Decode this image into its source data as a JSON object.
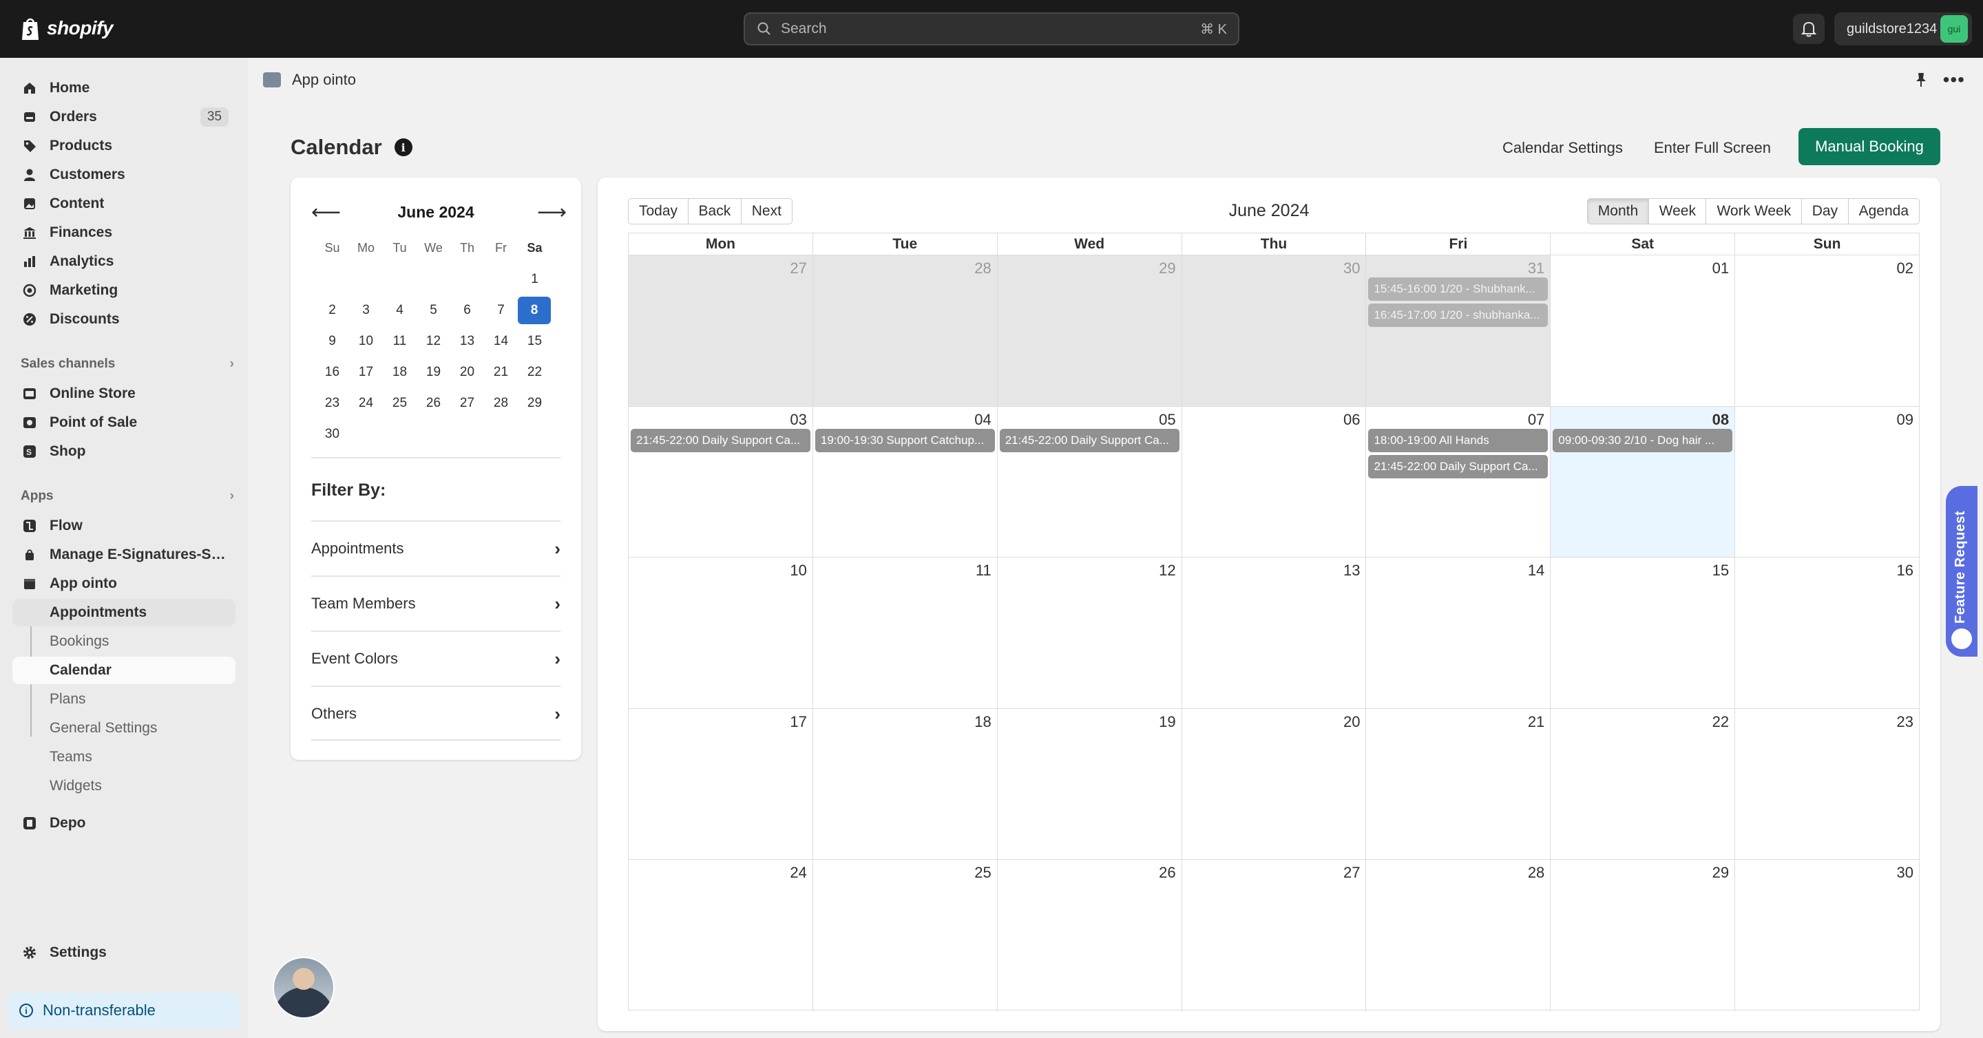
{
  "topbar": {
    "logo_text": "shopify",
    "search_placeholder": "Search",
    "search_shortcut": "⌘ K",
    "account_name": "guildstore1234",
    "account_avatar": "gui"
  },
  "sidebar": {
    "main": [
      {
        "label": "Home",
        "icon": "home-icon"
      },
      {
        "label": "Orders",
        "icon": "orders-icon",
        "badge": "35"
      },
      {
        "label": "Products",
        "icon": "tag-icon"
      },
      {
        "label": "Customers",
        "icon": "person-icon"
      },
      {
        "label": "Content",
        "icon": "content-icon"
      },
      {
        "label": "Finances",
        "icon": "bank-icon"
      },
      {
        "label": "Analytics",
        "icon": "chart-icon"
      },
      {
        "label": "Marketing",
        "icon": "target-icon"
      },
      {
        "label": "Discounts",
        "icon": "discount-icon"
      }
    ],
    "sales_channels_header": "Sales channels",
    "sales_channels": [
      {
        "label": "Online Store",
        "icon": "store-icon"
      },
      {
        "label": "Point of Sale",
        "icon": "pos-icon"
      },
      {
        "label": "Shop",
        "icon": "shop-icon"
      }
    ],
    "apps_header": "Apps",
    "apps": [
      {
        "label": "Flow",
        "icon": "flow-icon"
      },
      {
        "label": "Manage E-Signatures-Sig...",
        "icon": "signature-icon"
      },
      {
        "label": "App ointo",
        "icon": "calendar-app-icon"
      }
    ],
    "app_sub": [
      "Appointments",
      "Bookings",
      "Calendar",
      "Plans",
      "General Settings",
      "Teams",
      "Widgets"
    ],
    "depo": "Depo",
    "settings": "Settings",
    "non_transferable": "Non-transferable"
  },
  "app_header": {
    "title": "App ointo"
  },
  "page": {
    "title": "Calendar",
    "calendar_settings": "Calendar Settings",
    "full_screen": "Enter Full Screen",
    "manual_booking": "Manual Booking"
  },
  "mini_calendar": {
    "title": "June 2024",
    "dow": [
      "Su",
      "Mo",
      "Tu",
      "We",
      "Th",
      "Fr",
      "Sa"
    ],
    "weeks": [
      [
        "",
        "",
        "",
        "",
        "",
        "",
        "1"
      ],
      [
        "2",
        "3",
        "4",
        "5",
        "6",
        "7",
        "8"
      ],
      [
        "9",
        "10",
        "11",
        "12",
        "13",
        "14",
        "15"
      ],
      [
        "16",
        "17",
        "18",
        "19",
        "20",
        "21",
        "22"
      ],
      [
        "23",
        "24",
        "25",
        "26",
        "27",
        "28",
        "29"
      ],
      [
        "30",
        "",
        "",
        "",
        "",
        "",
        ""
      ]
    ],
    "selected": "8"
  },
  "filters": {
    "title": "Filter By:",
    "items": [
      "Appointments",
      "Team Members",
      "Event Colors",
      "Others"
    ]
  },
  "calendar": {
    "nav_buttons": [
      "Today",
      "Back",
      "Next"
    ],
    "title": "June 2024",
    "views": [
      "Month",
      "Week",
      "Work Week",
      "Day",
      "Agenda"
    ],
    "active_view": "Month",
    "dow": [
      "Mon",
      "Tue",
      "Wed",
      "Thu",
      "Fri",
      "Sat",
      "Sun"
    ],
    "weeks": [
      [
        {
          "num": "27",
          "off": true,
          "events": []
        },
        {
          "num": "28",
          "off": true,
          "events": []
        },
        {
          "num": "29",
          "off": true,
          "events": []
        },
        {
          "num": "30",
          "off": true,
          "events": []
        },
        {
          "num": "31",
          "off": true,
          "events": [
            "15:45-16:00 1/20 - Shubhank...",
            "16:45-17:00 1/20 - shubhanka..."
          ]
        },
        {
          "num": "01",
          "off": false,
          "events": []
        },
        {
          "num": "02",
          "off": false,
          "events": []
        }
      ],
      [
        {
          "num": "03",
          "off": false,
          "events": [
            "21:45-22:00 Daily Support Ca..."
          ]
        },
        {
          "num": "04",
          "off": false,
          "events": [
            "19:00-19:30 Support Catchup..."
          ]
        },
        {
          "num": "05",
          "off": false,
          "events": [
            "21:45-22:00 Daily Support Ca..."
          ]
        },
        {
          "num": "06",
          "off": false,
          "events": []
        },
        {
          "num": "07",
          "off": false,
          "events": [
            "18:00-19:00 All Hands",
            "21:45-22:00 Daily Support Ca..."
          ]
        },
        {
          "num": "08",
          "off": false,
          "today": true,
          "events": [
            "09:00-09:30 2/10 - Dog hair ..."
          ]
        },
        {
          "num": "09",
          "off": false,
          "events": []
        }
      ],
      [
        {
          "num": "10",
          "events": []
        },
        {
          "num": "11",
          "events": []
        },
        {
          "num": "12",
          "events": []
        },
        {
          "num": "13",
          "events": []
        },
        {
          "num": "14",
          "events": []
        },
        {
          "num": "15",
          "events": []
        },
        {
          "num": "16",
          "events": []
        }
      ],
      [
        {
          "num": "17",
          "events": []
        },
        {
          "num": "18",
          "events": []
        },
        {
          "num": "19",
          "events": []
        },
        {
          "num": "20",
          "events": []
        },
        {
          "num": "21",
          "events": []
        },
        {
          "num": "22",
          "events": []
        },
        {
          "num": "23",
          "events": []
        }
      ],
      [
        {
          "num": "24",
          "events": []
        },
        {
          "num": "25",
          "events": []
        },
        {
          "num": "26",
          "events": []
        },
        {
          "num": "27",
          "events": []
        },
        {
          "num": "28",
          "events": []
        },
        {
          "num": "29",
          "events": []
        },
        {
          "num": "30",
          "events": []
        }
      ]
    ]
  },
  "feature_request": "Feature Request",
  "colors": {
    "accent": "#0d7a5c",
    "selected": "#2c6ecb",
    "event": "#919191",
    "today_bg": "#eaf6ff",
    "feature": "#5a6de0"
  }
}
